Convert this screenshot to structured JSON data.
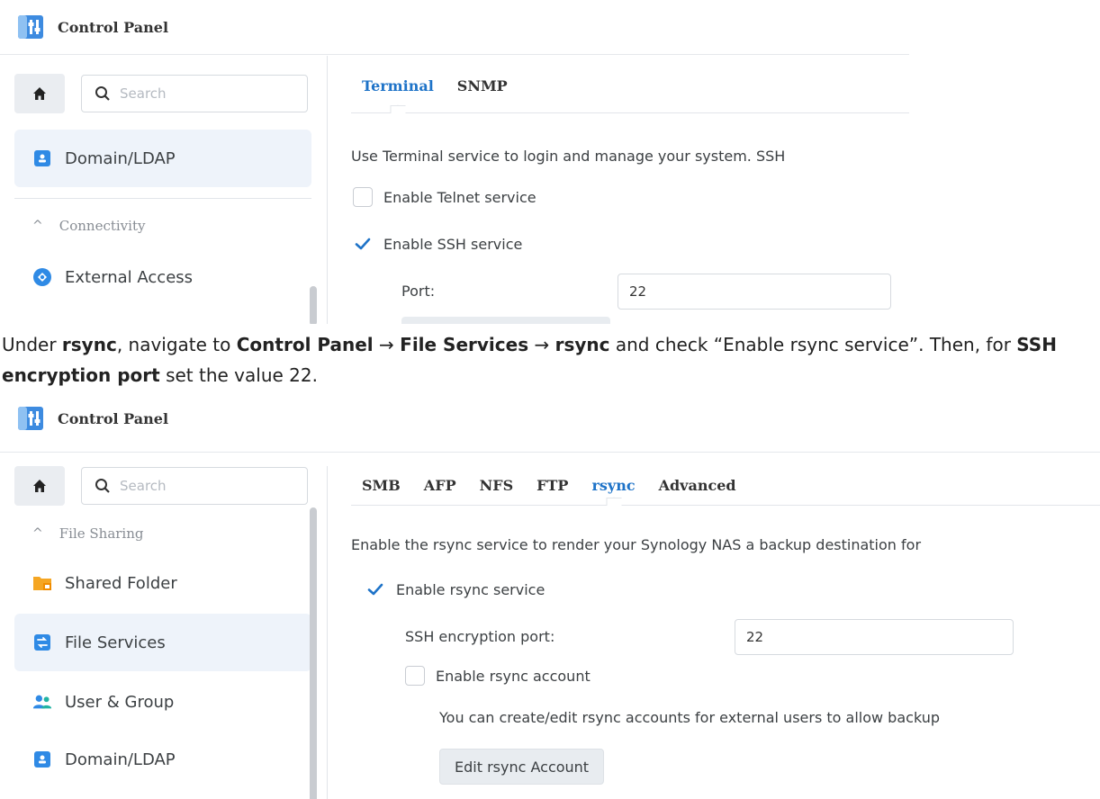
{
  "colors": {
    "accent": "#1e73c8",
    "check": "#1e73c8",
    "active_bg": "#eef3fa"
  },
  "panel1": {
    "app_title": "Control Panel",
    "search_placeholder": "Search",
    "sidebar": {
      "domain_ldap": "Domain/LDAP",
      "section_connectivity": "Connectivity",
      "external_access": "External Access"
    },
    "tabs": [
      "Terminal",
      "SNMP"
    ],
    "description": "Use Terminal service to login and manage your system. SSH",
    "telnet_label": "Enable Telnet service",
    "telnet_checked": false,
    "ssh_label": "Enable SSH service",
    "ssh_checked": true,
    "port_label": "Port:",
    "port_value": "22"
  },
  "caption": {
    "p1": "Under ",
    "b1": "rsync",
    "p2": ", navigate to ",
    "b2": "Control Panel",
    "p3": " → ",
    "b3": "File Services",
    "p4": " → ",
    "b4": "rsync",
    "p5": " and check “Enable rsync service”. Then, for ",
    "b5": "SSH encryption port",
    "p6": " set the value 22."
  },
  "panel2": {
    "app_title": "Control Panel",
    "search_placeholder": "Search",
    "sidebar": {
      "section_file_sharing": "File Sharing",
      "shared_folder": "Shared Folder",
      "file_services": "File Services",
      "user_group": "User & Group",
      "domain_ldap": "Domain/LDAP"
    },
    "tabs": [
      "SMB",
      "AFP",
      "NFS",
      "FTP",
      "rsync",
      "Advanced"
    ],
    "description": "Enable the rsync service to render your Synology NAS a backup destination for",
    "rsync_label": "Enable rsync service",
    "rsync_checked": true,
    "ssh_port_label": "SSH encryption port:",
    "ssh_port_value": "22",
    "account_label": "Enable rsync account",
    "account_checked": false,
    "account_note": "You can create/edit rsync accounts for external users to allow backup",
    "edit_button": "Edit rsync Account"
  }
}
